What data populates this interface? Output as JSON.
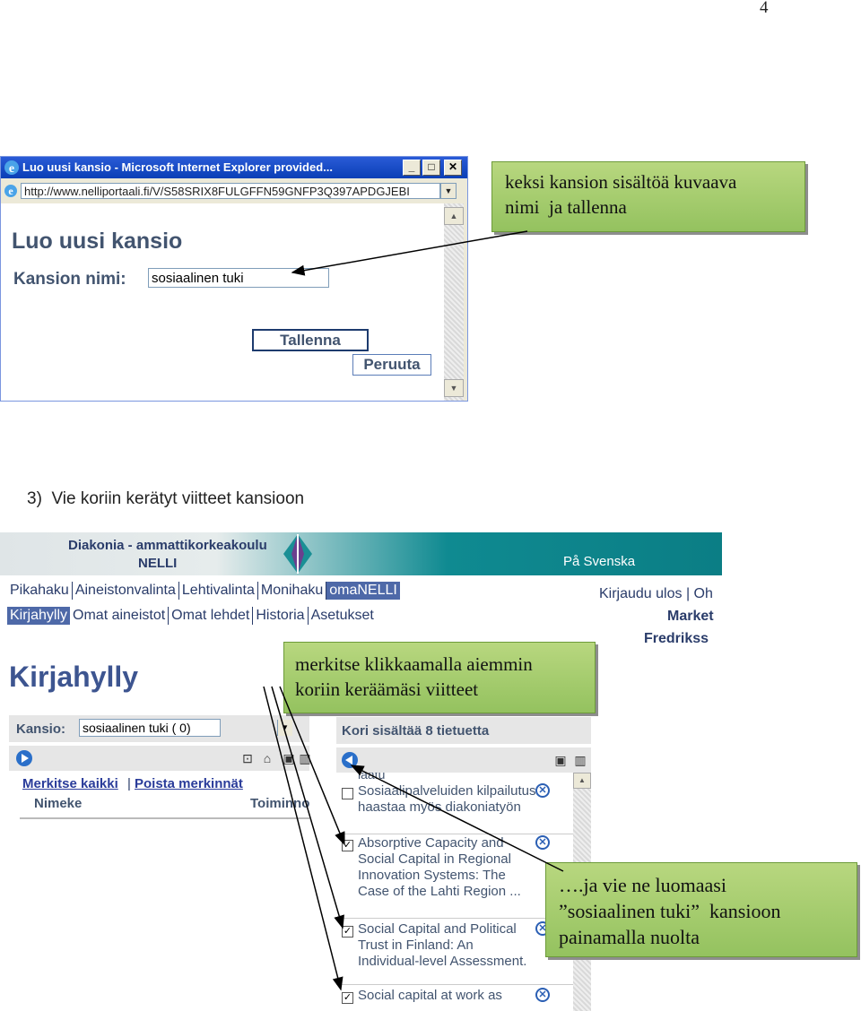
{
  "page_number": "4",
  "ie_window": {
    "title": "Luo uusi kansio - Microsoft Internet Explorer provided...",
    "address": "http://www.nelliportaali.fi/V/S58SRIX8FULGFFN59GNFP3Q397APDGJEBI",
    "dialog": {
      "title": "Luo uusi kansio",
      "name_label": "Kansion nimi:",
      "name_value": "sosiaalinen tuki",
      "save_label": "Tallenna",
      "cancel_label": "Peruuta"
    }
  },
  "callouts": {
    "save_hint": [
      "keksi kansion sisältöä kuvaava",
      "nimi  ja tallenna"
    ],
    "mark_hint": [
      "merkitse klikkaamalla aiemmin",
      "koriin keräämäsi viitteet"
    ],
    "move_hint": [
      "….ja vie ne luomaasi",
      "”sosiaalinen tuki”  kansioon",
      "painamalla nuolta"
    ]
  },
  "step_heading": "3)  Vie koriin kerätyt viitteet kansioon",
  "nelli": {
    "org": "Diakonia - ammattikorkeakoulu",
    "name": "NELLI",
    "swedish_link": "På Svenska",
    "nav_primary": [
      "Pikahaku",
      "Aineistonvalinta",
      "Lehtivalinta",
      "Monihaku",
      "omaNELLI"
    ],
    "nav_secondary": [
      "Kirjahylly",
      "Omat aineistot",
      "Omat lehdet",
      "Historia",
      "Asetukset"
    ],
    "login_links": "Kirjaudu ulos | Oh",
    "user_first": "Market",
    "user_last": "Fredrikss",
    "page_title": "Kirjahylly",
    "folder_label": "Kansio:",
    "folder_value": "sosiaalinen tuki ( 0)",
    "mark_all": "Merkitse kaikki",
    "unmark": "Poista merkinnät",
    "col_name": "Nimeke",
    "col_actions": "Toiminnot",
    "basket_title": "Kori sisältää 8 tietuetta",
    "sort_label": "laatu",
    "basket_items": [
      {
        "checked": false,
        "title": "Sosiaalipalveluiden kilpailutus haastaa myös diakoniatyön"
      },
      {
        "checked": true,
        "title": "Absorptive Capacity and Social Capital in Regional Innovation Systems: The Case of the Lahti Region ..."
      },
      {
        "checked": true,
        "title": "Social Capital and Political Trust in Finland: An Individual-level Assessment."
      },
      {
        "checked": true,
        "title": "Social capital at work as"
      }
    ]
  },
  "colors": {
    "callout_green": "#a6cc6e",
    "nelli_teal": "#0f8a91",
    "nav_active": "#4e69a8",
    "text_navy": "#42546f"
  }
}
